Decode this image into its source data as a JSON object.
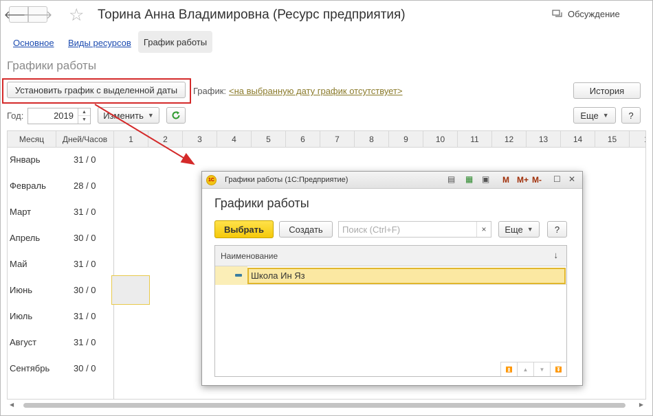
{
  "window": {
    "title": "Торина Анна Владимировна (Ресурс предприятия)",
    "discussion_label": "Обсуждение"
  },
  "nav": {
    "links": [
      "Основное",
      "Виды ресурсов"
    ],
    "active_tab": "График работы"
  },
  "section_title": "Графики работы",
  "toolbar": {
    "set_schedule_button": "Установить график с выделенной даты",
    "schedule_label": "График:",
    "schedule_link": "<на выбранную дату график отсутствует>",
    "history_button": "История",
    "year_label": "Год:",
    "year_value": "2019",
    "change_button": "Изменить",
    "more_button": "Еще",
    "help_button": "?"
  },
  "calendar": {
    "col_month": "Месяц",
    "col_days": "Дней/Часов",
    "day_columns": [
      "1",
      "2",
      "3",
      "4",
      "5",
      "6",
      "7",
      "8",
      "9",
      "10",
      "11",
      "12",
      "13",
      "14",
      "15",
      "1"
    ],
    "rows": [
      {
        "month": "Январь",
        "days": "31 / 0"
      },
      {
        "month": "Февраль",
        "days": "28 / 0"
      },
      {
        "month": "Март",
        "days": "31 / 0"
      },
      {
        "month": "Апрель",
        "days": "30 / 0"
      },
      {
        "month": "Май",
        "days": "31 / 0"
      },
      {
        "month": "Июнь",
        "days": "30 / 0"
      },
      {
        "month": "Июль",
        "days": "31 / 0"
      },
      {
        "month": "Август",
        "days": "31 / 0"
      },
      {
        "month": "Сентябрь",
        "days": "30 / 0"
      }
    ]
  },
  "dialog": {
    "caption": "Графики работы  (1С:Предприятие)",
    "logo_text": "1С",
    "title": "Графики работы",
    "select_button": "Выбрать",
    "create_button": "Создать",
    "search_placeholder": "Поиск (Ctrl+F)",
    "clear_label": "×",
    "more_button": "Еще",
    "help_button": "?",
    "column_name": "Наименование",
    "sort_indicator": "↓",
    "items": [
      "Школа Ин Яз"
    ],
    "window_controls": [
      "M",
      "M+",
      "M-"
    ]
  },
  "colors": {
    "accent_yellow": "#f5c90a",
    "highlight_row": "#fbe8a2",
    "annotation_red": "#d42a2a",
    "link_blue": "#1c4bb0"
  }
}
